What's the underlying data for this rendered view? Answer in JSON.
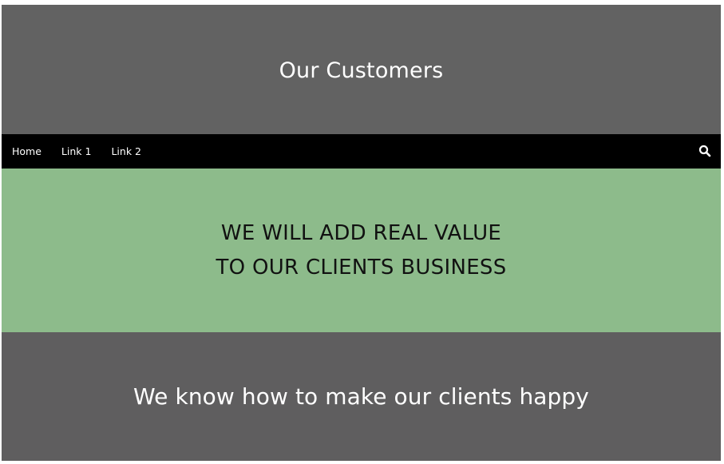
{
  "header": {
    "title": "Our Customers"
  },
  "nav": {
    "links": [
      "Home",
      "Link 1",
      "Link 2"
    ],
    "search_icon": "search-icon"
  },
  "hero": {
    "line1": "WE WILL ADD REAL VALUE",
    "line2": "TO OUR CLIENTS BUSINESS"
  },
  "footer": {
    "text": "We know how to make our clients happy"
  },
  "colors": {
    "header_bg": "#626262",
    "nav_bg": "#000000",
    "hero_bg": "#8dbb8b",
    "footer_bg": "#5f5e5f"
  }
}
